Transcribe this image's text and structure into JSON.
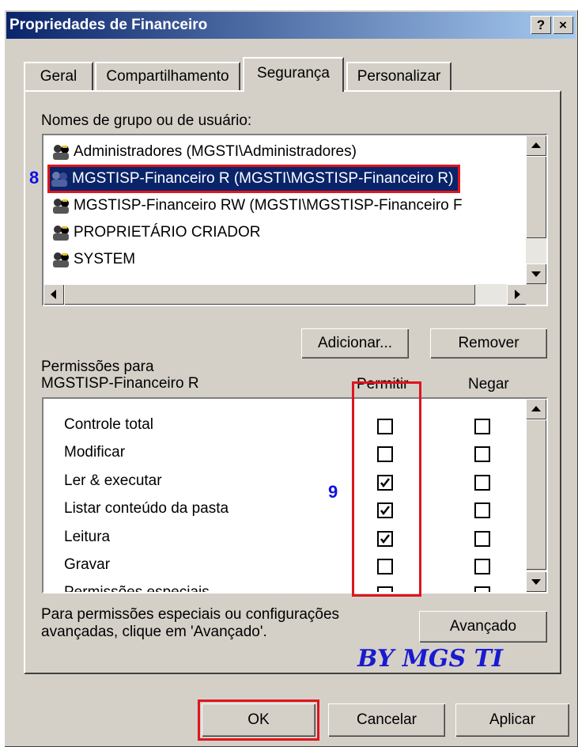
{
  "window": {
    "title": "Propriedades de Financeiro",
    "help_glyph": "?",
    "close_glyph": "×"
  },
  "tabs": [
    {
      "label": "Geral"
    },
    {
      "label": "Compartilhamento"
    },
    {
      "label": "Segurança",
      "active": true
    },
    {
      "label": "Personalizar"
    }
  ],
  "groups": {
    "label": "Nomes de grupo ou de usuário:",
    "items": [
      {
        "label": "Administradores (MGSTI\\Administradores)"
      },
      {
        "label": "MGSTISP-Financeiro R (MGSTI\\MGSTISP-Financeiro R)",
        "selected": true
      },
      {
        "label": "MGSTISP-Financeiro RW (MGSTI\\MGSTISP-Financeiro F"
      },
      {
        "label": "PROPRIETÁRIO CRIADOR"
      },
      {
        "label": "SYSTEM"
      }
    ],
    "add_button": "Adicionar...",
    "remove_button": "Remover"
  },
  "permissions": {
    "label_line1": "Permissões para",
    "label_line2": "MGSTISP-Financeiro R",
    "col_allow": "Permitir",
    "col_deny": "Negar",
    "rows": [
      {
        "label": "Controle total",
        "allow": false,
        "deny": false
      },
      {
        "label": "Modificar",
        "allow": false,
        "deny": false
      },
      {
        "label": "Ler & executar",
        "allow": true,
        "deny": false
      },
      {
        "label": "Listar conteúdo da pasta",
        "allow": true,
        "deny": false
      },
      {
        "label": "Leitura",
        "allow": true,
        "deny": false
      },
      {
        "label": "Gravar",
        "allow": false,
        "deny": false
      },
      {
        "label": "Permissões especiais",
        "allow": false,
        "deny": false
      }
    ]
  },
  "advanced": {
    "hint_line1": "Para permissões especiais ou configurações",
    "hint_line2": "avançadas, clique em 'Avançado'.",
    "button": "Avançado"
  },
  "annotations": {
    "marker_8": "8",
    "marker_9": "9",
    "watermark": "BY MGS TI"
  },
  "footer": {
    "ok": "OK",
    "cancel": "Cancelar",
    "apply": "Aplicar"
  },
  "colors": {
    "face": "#d4d0c8",
    "title_start": "#0a246a",
    "title_end": "#a6caf0",
    "highlight": "#e0141e",
    "annotation": "#1010e0"
  }
}
